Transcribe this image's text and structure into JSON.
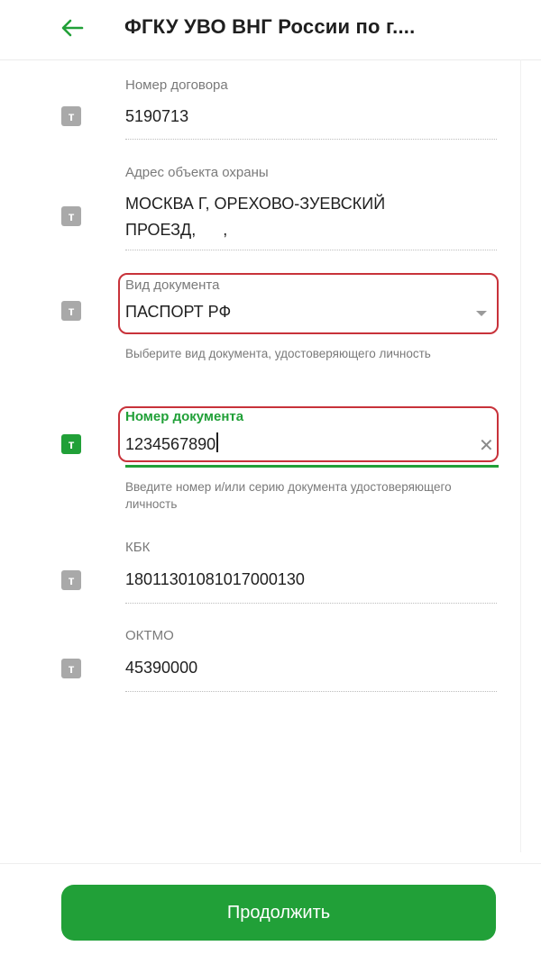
{
  "header": {
    "back_icon": "arrow-left-icon",
    "title": "ФГКУ УВО ВНГ России по г...."
  },
  "fields": {
    "contract": {
      "icon_letter": "т",
      "label": "Номер договора",
      "value": "5190713"
    },
    "address": {
      "icon_letter": "т",
      "label": "Адрес объекта охраны",
      "value_line1": "МОСКВА Г, ОРЕХОВО-ЗУЕВСКИЙ",
      "value_line2": "ПРОЕЗД,      ,"
    },
    "doc_type": {
      "icon_letter": "т",
      "label": "Вид документа",
      "value": "ПАСПОРТ РФ",
      "hint": "Выберите вид документа, удостоверяющего личность",
      "dropdown_icon": "chevron-down-icon"
    },
    "doc_number": {
      "icon_letter": "т",
      "label": "Номер документа",
      "value": "1234567890",
      "hint": "Введите номер и/или серию документа удостоверяющего личность",
      "clear_icon": "close-icon"
    },
    "kbk": {
      "icon_letter": "т",
      "label": "КБК",
      "value": "18011301081017000130"
    },
    "oktmo": {
      "icon_letter": "т",
      "label": "ОКТМО",
      "value": "45390000"
    }
  },
  "footer": {
    "continue_label": "Продолжить"
  },
  "colors": {
    "accent": "#21a038",
    "highlight_border": "#c8323a",
    "icon_inactive": "#a9a9a9"
  }
}
